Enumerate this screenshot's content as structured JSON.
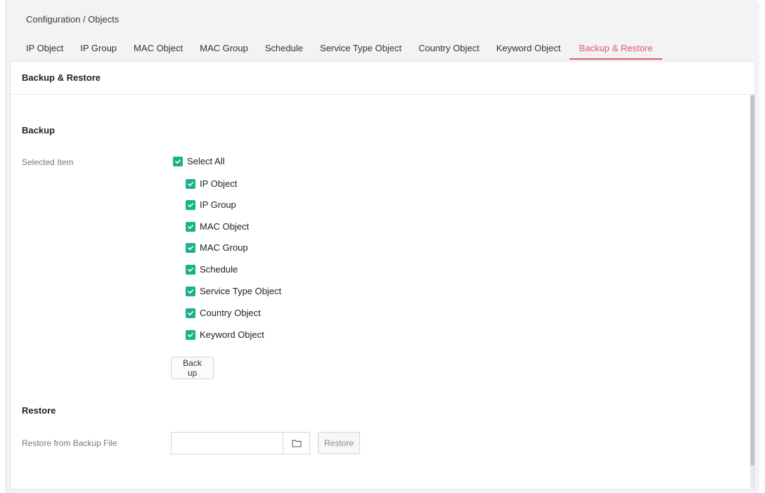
{
  "breadcrumb": "Configuration / Objects",
  "tabs": [
    {
      "label": "IP Object"
    },
    {
      "label": "IP Group"
    },
    {
      "label": "MAC Object"
    },
    {
      "label": "MAC Group"
    },
    {
      "label": "Schedule"
    },
    {
      "label": "Service Type Object"
    },
    {
      "label": "Country Object"
    },
    {
      "label": "Keyword Object"
    },
    {
      "label": "Backup & Restore",
      "active": true
    }
  ],
  "panel": {
    "title": "Backup & Restore"
  },
  "backup": {
    "title": "Backup",
    "selected_item_label": "Selected Item",
    "select_all": {
      "label": "Select All",
      "checked": true
    },
    "items": [
      {
        "label": "IP Object",
        "checked": true
      },
      {
        "label": "IP Group",
        "checked": true
      },
      {
        "label": "MAC Object",
        "checked": true
      },
      {
        "label": "MAC Group",
        "checked": true
      },
      {
        "label": "Schedule",
        "checked": true
      },
      {
        "label": "Service Type Object",
        "checked": true
      },
      {
        "label": "Country Object",
        "checked": true
      },
      {
        "label": "Keyword Object",
        "checked": true
      }
    ],
    "backup_button": "Back up"
  },
  "restore": {
    "title": "Restore",
    "file_label": "Restore from Backup File",
    "file_value": "",
    "folder_icon": "folder-icon",
    "restore_button": "Restore"
  },
  "colors": {
    "accent": "#e05b67",
    "checkbox": "#19b28c"
  }
}
